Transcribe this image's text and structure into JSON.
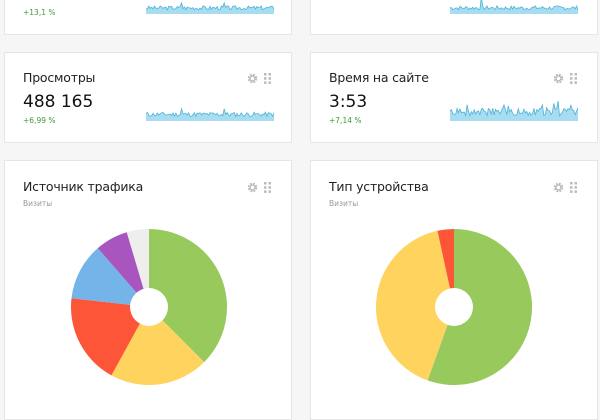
{
  "cards": {
    "visits": {
      "change": "+13,1 %"
    },
    "users": {},
    "pageviews": {
      "title": "Просмотры",
      "value": "488 165",
      "change": "+6,99 %"
    },
    "time_on_site": {
      "title": "Время на сайте",
      "value": "3:53",
      "change": "+7,14 %"
    },
    "traffic_source": {
      "title": "Источник трафика",
      "subtitle": "Визиты"
    },
    "device_type": {
      "title": "Тип устройства",
      "subtitle": "Визиты"
    }
  },
  "icons": {
    "settings": "gear-icon",
    "drag": "grip-icon"
  },
  "colors": {
    "green": "#97c95d",
    "yellow": "#fed35e",
    "red": "#fd5537",
    "blue": "#74b4e8",
    "purple": "#a855c0",
    "gray": "#eeeeec",
    "spark_fill": "#a8dcf0",
    "spark_line": "#4cb3d8",
    "positive": "#3c9a3c"
  },
  "chart_data": [
    {
      "type": "pie",
      "title": "Источник трафика",
      "subtitle": "Визиты",
      "values": [
        37.5,
        20.5,
        18.8,
        11.8,
        6.8,
        4.6
      ],
      "colors": [
        "#97c95d",
        "#fed35e",
        "#fd5537",
        "#74b4e8",
        "#a855c0",
        "#eeeeec"
      ]
    },
    {
      "type": "pie",
      "title": "Тип устройства",
      "subtitle": "Визиты",
      "values": [
        55.5,
        41.1,
        3.4
      ],
      "colors": [
        "#97c95d",
        "#fed35e",
        "#fd5537"
      ]
    }
  ]
}
